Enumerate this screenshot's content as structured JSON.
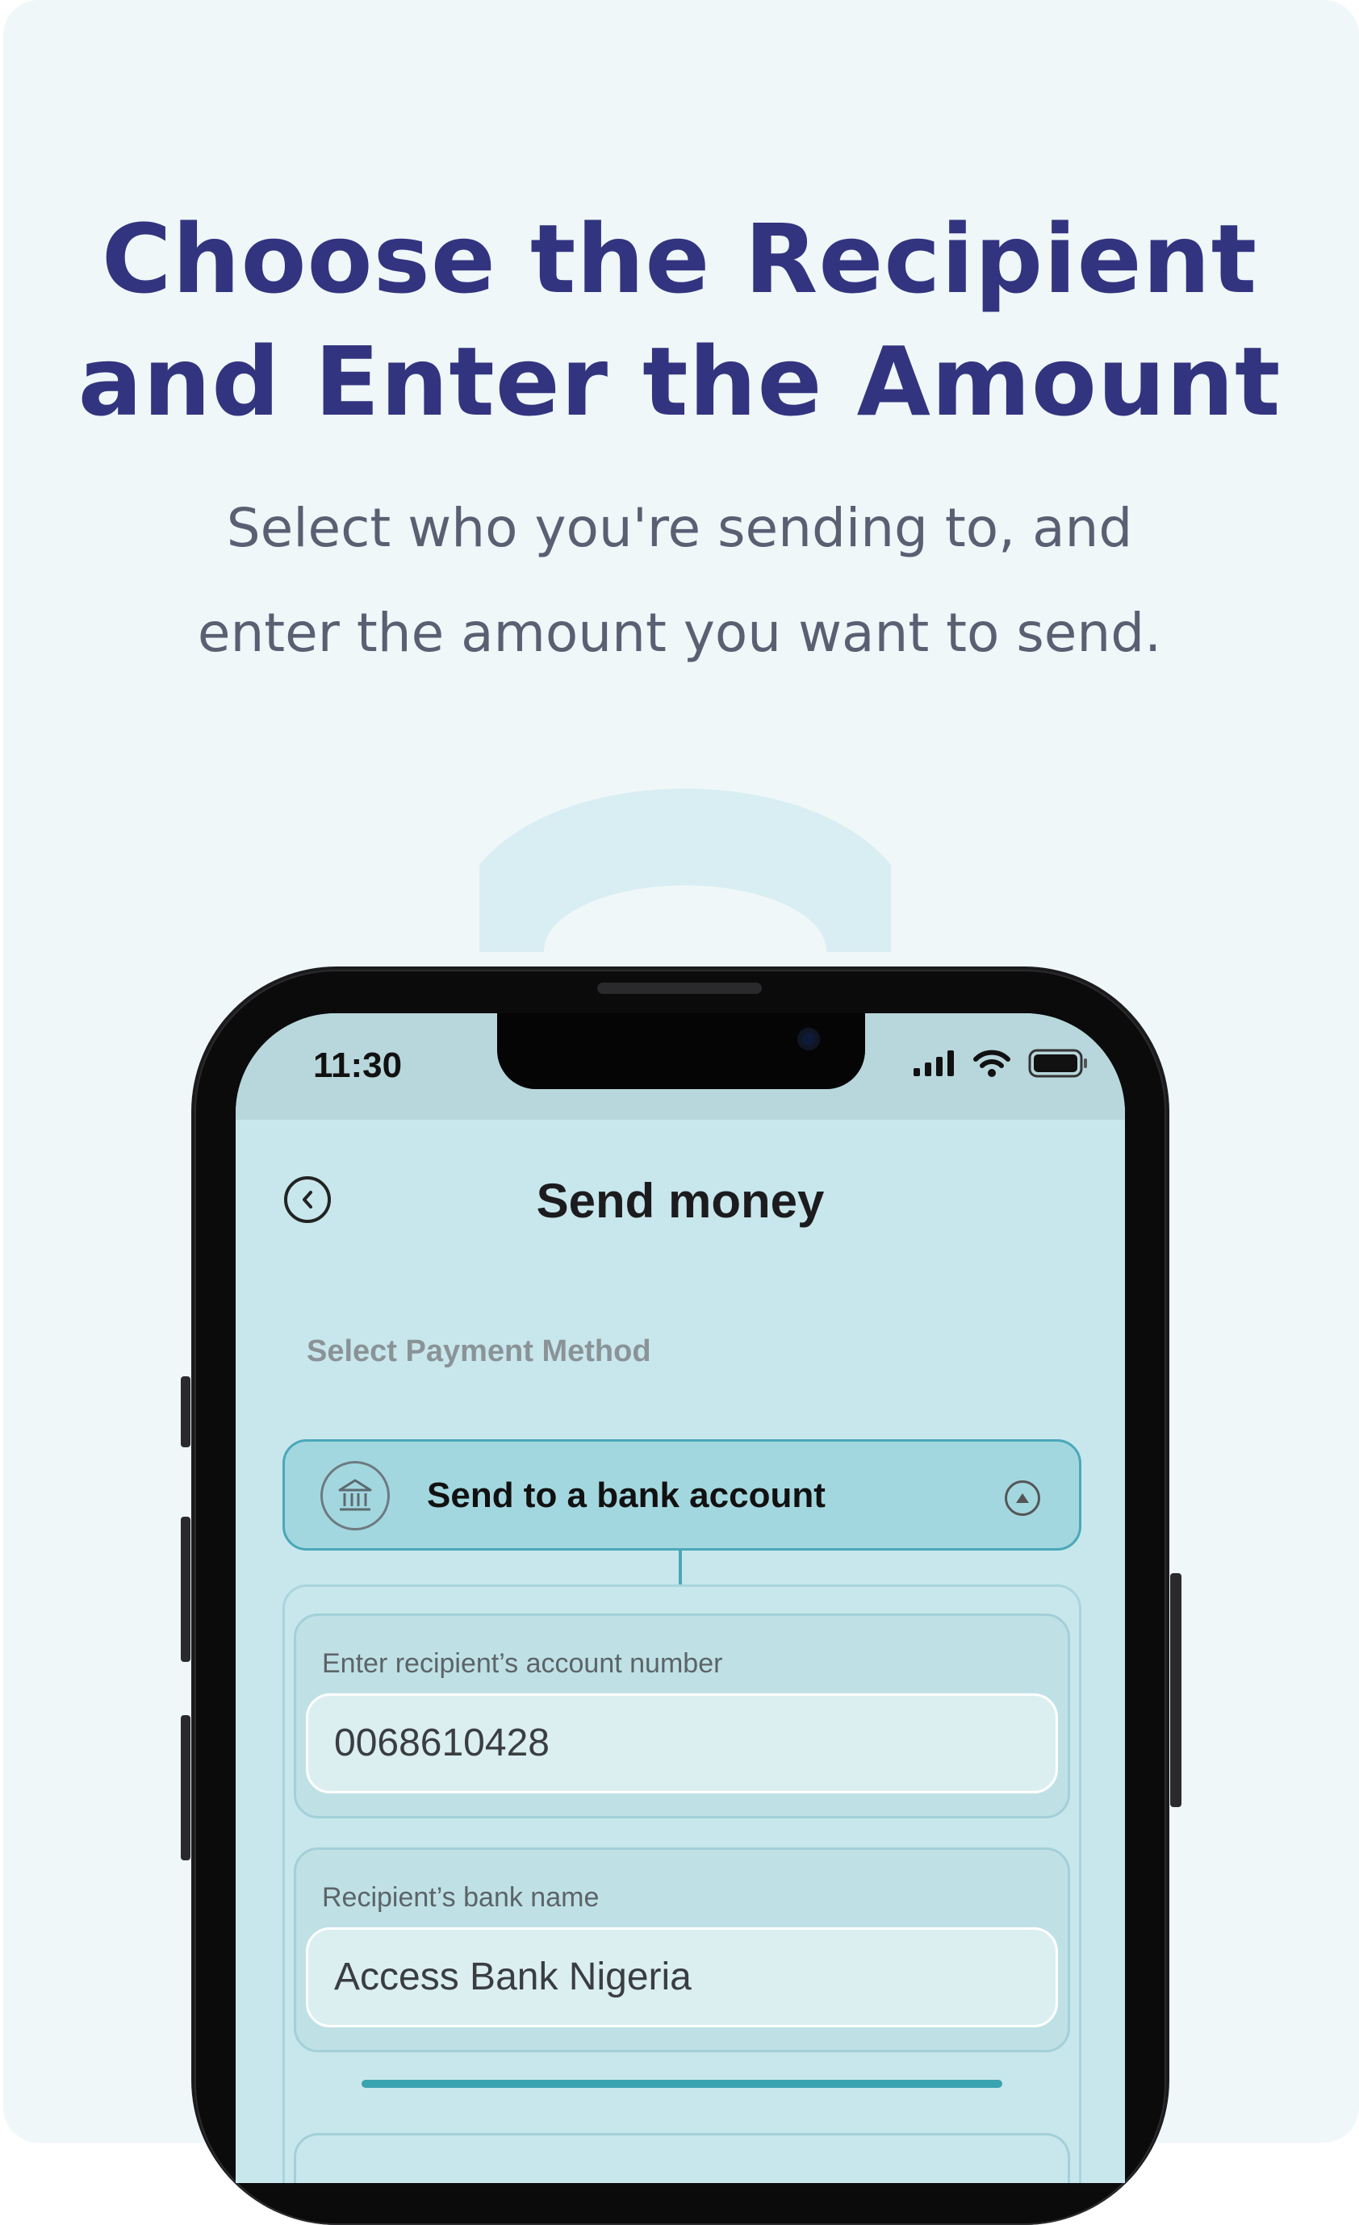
{
  "hero": {
    "headline_line1": "Choose the Recipient",
    "headline_line2": "and Enter the Amount",
    "sub_line1": "Select who you're sending to, and",
    "sub_line2": "enter the amount you want to send."
  },
  "status_bar": {
    "time": "11:30",
    "icons": [
      "signal-icon",
      "wifi-icon",
      "battery-icon"
    ]
  },
  "app": {
    "title": "Send money",
    "back_icon": "chevron-left-icon",
    "section_label": "Select Payment Method",
    "payment_method": {
      "label": "Send to a bank account",
      "icon": "bank-icon",
      "toggle_icon": "triangle-up-icon"
    },
    "account_number": {
      "label": "Enter recipient’s account number",
      "value": "0068610428"
    },
    "bank_name": {
      "label": "Recipient’s bank name",
      "value": "Access Bank Nigeria"
    }
  },
  "colors": {
    "headline": "#33347f",
    "subtext": "#5a5f72",
    "card_background": "#eff7f9",
    "screen_background": "#c8e7ec",
    "accent": "#3aa3b0"
  }
}
